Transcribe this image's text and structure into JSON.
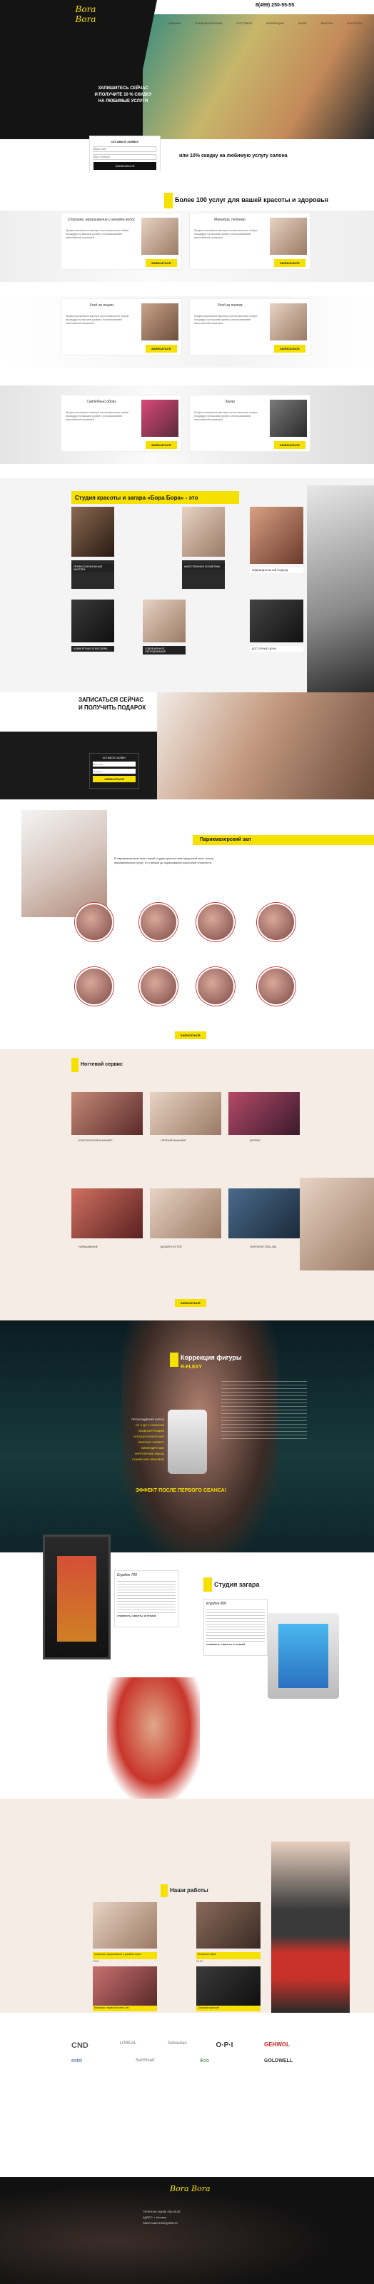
{
  "header": {
    "phone": "8(499) 250-55-55",
    "nav": [
      "ГЛАВНАЯ",
      "ПАРИКМАХЕРСКАЯ",
      "НОГТЕВОЙ",
      "КОРРЕКЦИЯ",
      "ЗАГАР",
      "РАБОТЫ",
      "КОНТАКТЫ"
    ]
  },
  "hero": {
    "logo_text": "Bora Bora",
    "headline_l1": "ЗАПИШИТЕСЬ СЕЙЧАС",
    "headline_l2": "И ПОЛУЧИТЕ 10 % СКИДКУ",
    "headline_l3": "НА ЛЮБИМЫЕ УСЛУГИ",
    "form_title": "ОСТАВЬТЕ ЗАЯВКУ",
    "name_placeholder": "Ваше имя",
    "phone_placeholder": "Ваш телефон",
    "submit": "ЗАПИСАТЬСЯ",
    "banner": "или 10% скидку на любимую услугу салона"
  },
  "services": {
    "title": "Более 100 услуг для вашей красоты и здоровья",
    "cards": [
      {
        "title": "Стрижка, окрашивание и укладка волос",
        "btn": "ЗАПИСАТЬСЯ"
      },
      {
        "title": "Маникюр, педикюр",
        "btn": "ЗАПИСАТЬСЯ"
      },
      {
        "title": "Уход за лицом",
        "btn": "ЗАПИСАТЬСЯ"
      },
      {
        "title": "Уход за телом",
        "btn": "ЗАПИСАТЬСЯ"
      },
      {
        "title": "Свадебный образ",
        "btn": "ЗАПИСАТЬСЯ"
      },
      {
        "title": "Загар",
        "btn": "ЗАПИСАТЬСЯ"
      }
    ],
    "card_text": "Профессиональные мастера салона выполнят любую процедуру на высшем уровне с использованием качественной косметики."
  },
  "studio": {
    "title": "Студия красоты и загара «Бора Бора» - это",
    "items": [
      "ПРОФЕССИОНАЛЬНЫЕ МАСТЕРА",
      "КАЧЕСТВЕННАЯ КОСМЕТИКА",
      "ИНДИВИДУАЛЬНЫЙ ПОДХОД",
      "КОМФОРТНАЯ АТМОСФЕРА",
      "СОВРЕМЕННОЕ ОБОРУДОВАНИЕ",
      "ДОСТУПНЫЕ ЦЕНЫ"
    ]
  },
  "signup": {
    "title_l1": "ЗАПИСАТЬСЯ СЕЙЧАС",
    "title_l2": "И ПОЛУЧИТЬ ПОДАРОК",
    "form_title": "ОСТАВЬТЕ ЗАЯВКУ",
    "name_placeholder": "Ваше имя",
    "phone_placeholder": "Телефон",
    "submit": "ЗАПИСАТЬСЯ"
  },
  "hair": {
    "title": "Парикмахерский зал",
    "text": "В парикмахерском зале нашей студии красоты вам предложат весь спектр парикмахерских услуг: от стрижки до окрашивания различной сложности.",
    "btn": "ЗАПИСАТЬСЯ"
  },
  "nails": {
    "title": "Ногтевой сервис",
    "items": [
      "КЛАССИЧЕСКИЙ МАНИКЮР",
      "ГОРЯЧИЙ МАНИКЮР",
      "ШЕЛЛАК",
      "НАРАЩИВАНИЕ",
      "ДИЗАЙН НОГТЕЙ",
      "ПОКРЫТИЕ ГЕЛЬ-ЛАК"
    ],
    "btn": "ЗАПИСАТЬСЯ"
  },
  "correction": {
    "title": "Коррекция фигуры",
    "subtitle": "R-FLEXY",
    "list": [
      "ПРОХОЖДЕНИЕ КУРСА",
      "ОТ 2 ДО 4 СЕАНСОВ",
      "МОДЕЛИРУЮЩИЙ",
      "АНТИЦЕЛЛЮЛИТНЫЙ",
      "ЛИФТИНГ-ЭФФЕКТ",
      "ЛИМФОДРЕНАЖ",
      "УКРЕПЛЕНИЕ МЫШЦ",
      "СНИЖЕНИЕ ОБЪЕМОВ"
    ],
    "effect": "ЭФФЕКТ ПОСЛЕ ПЕРВОГО СЕАНСА!"
  },
  "tan": {
    "title": "Студия загара",
    "box1_title": "Ergoline 700",
    "box2_title": "Ergoline 800",
    "price1": "СТОИМОСТЬ 1 МИНУТЫ: 25 РУБЛЕЙ",
    "price2": "СТОИМОСТЬ 1 МИНУТЫ: 27 РУБЛЕЙ"
  },
  "works": {
    "title": "Наши работы",
    "items": [
      {
        "cap": "Стрижка, окрашивание и укладка волос",
        "date": "23.02"
      },
      {
        "cap": "Вечерний образ",
        "date": "23.02"
      },
      {
        "cap": "Маникюр, покрытие гель-лак",
        "date": "23.02"
      },
      {
        "cap": "Стрижка мужская",
        "date": "23.02"
      }
    ]
  },
  "brands": [
    "CND",
    "LOREAL",
    "Sebastian",
    "O·P·I",
    "GEHWOL",
    "estel",
    "SanSmart",
    "ikoo",
    "GOLDWELL"
  ],
  "footer": {
    "logo_text": "Bora Bora",
    "line1": "ТЕЛЕФОН: 8(499) 250-55-55",
    "line2": "АДРЕС: г. Москва",
    "line3": "РАБОТАЕМ ЕЖЕДНЕВНО"
  },
  "colors": {
    "accent": "#f5e000",
    "dark": "#111111"
  }
}
